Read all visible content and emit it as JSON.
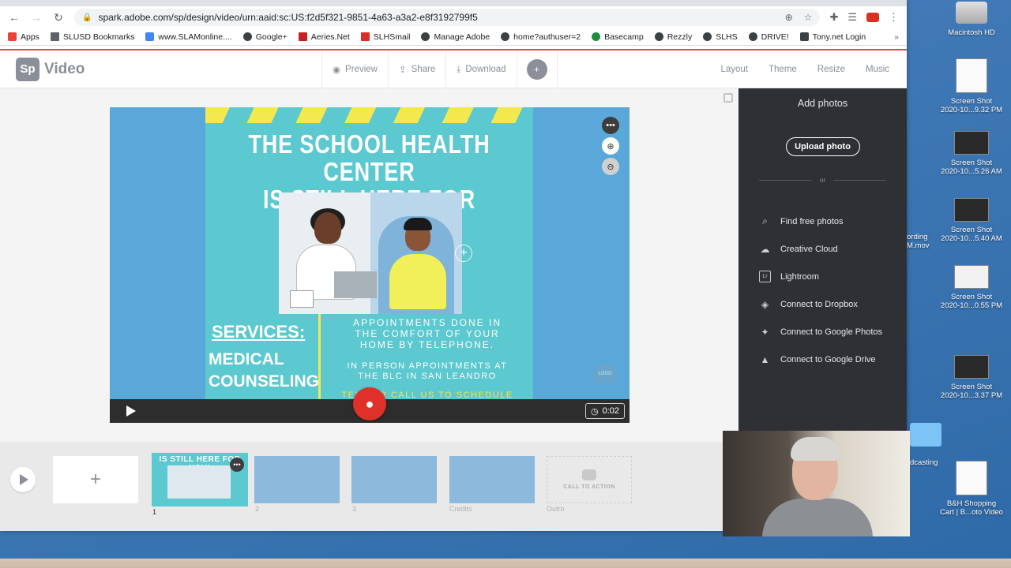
{
  "browser": {
    "url": "spark.adobe.com/sp/design/video/urn:aaid:sc:US:f2d5f321-9851-4a63-a3a2-e8f3192799f5",
    "bookmarks": [
      "Apps",
      "SLUSD Bookmarks",
      "www.SLAMonline....",
      "Google+",
      "Aeries.Net",
      "SLHSmail",
      "Manage Adobe",
      "home?authuser=2",
      "Basecamp",
      "Rezzly",
      "SLHS",
      "DRIVE!",
      "Tony.net Login"
    ],
    "bookmarks_more": "»"
  },
  "app": {
    "logo_mark": "Sp",
    "logo_text": "Video",
    "header_actions": [
      "Preview",
      "Share",
      "Download"
    ],
    "header_right": [
      "Layout",
      "Theme",
      "Resize",
      "Music"
    ]
  },
  "canvas": {
    "poster_title_line1": "THE SCHOOL HEALTH CENTER",
    "poster_title_line2": "IS STILL HERE FOR YOU!",
    "services_heading": "SERVICES:",
    "services_line1": "MEDICAL",
    "services_line2": "COUNSELING",
    "appt_line1": "APPOINTMENTS DONE IN",
    "appt_line2": "THE COMFORT OF YOUR",
    "appt_line3": "HOME BY TELEPHONE.",
    "appt_line4": "IN PERSON APPOINTMENTS AT",
    "appt_line5": "THE BLC IN SAN LEANDRO",
    "appt_line6": "TEXT OR CALL US TO SCHEDULE",
    "logo_slot": "LOGO",
    "duration": "0:02"
  },
  "side_panel": {
    "title": "Add photos",
    "upload_label": "Upload photo",
    "or_text": "or",
    "sources": [
      {
        "label": "Find free photos",
        "icon": "search-icon"
      },
      {
        "label": "Creative Cloud",
        "icon": "creative-cloud-icon"
      },
      {
        "label": "Lightroom",
        "icon": "lightroom-icon"
      },
      {
        "label": "Connect to Dropbox",
        "icon": "dropbox-icon"
      },
      {
        "label": "Connect to Google Photos",
        "icon": "google-photos-icon"
      },
      {
        "label": "Connect to Google Drive",
        "icon": "google-drive-icon"
      }
    ]
  },
  "timeline": {
    "add_symbol": "+",
    "active_thumb_title": "IS STILL HERE FOR YOU!",
    "slides": [
      "1",
      "2",
      "3",
      "Credits",
      "Outro"
    ],
    "outro_text": "CALL TO ACTION"
  },
  "desktop": {
    "items": [
      {
        "label_line1": "Macintosh HD",
        "label_line2": ""
      },
      {
        "label_line1": "Screen Shot",
        "label_line2": "2020-10...9.32 PM"
      },
      {
        "label_line1": "Screen Shot",
        "label_line2": "2020-10...5.26 AM"
      },
      {
        "label_line1": "Screen Shot",
        "label_line2": "2020-10...5.40 AM"
      },
      {
        "label_line1": "Screen Shot",
        "label_line2": "2020-10...0.55 PM"
      },
      {
        "label_line1": "Screen Shot",
        "label_line2": "2020-10...3.37 PM"
      },
      {
        "label_line1": "B&H Shopping",
        "label_line2": "Cart | B...oto Video"
      }
    ],
    "partial_recording_line1": "ording",
    "partial_recording_line2": "M.mov",
    "partial_podcasting": "dcasting"
  }
}
